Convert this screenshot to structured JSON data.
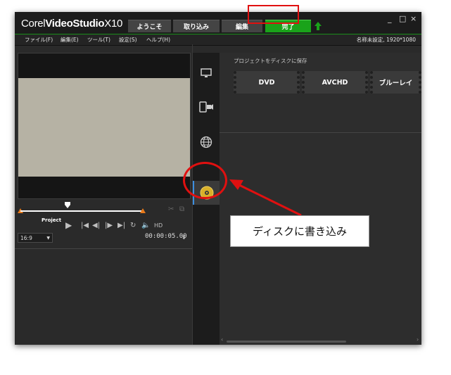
{
  "app": {
    "brand_left": "Corel",
    "brand_right": "VideoStudio",
    "brand_version": "X10"
  },
  "tabs": [
    {
      "label": "ようこそ"
    },
    {
      "label": "取り込み"
    },
    {
      "label": "編集"
    },
    {
      "label": "完了"
    }
  ],
  "window_controls": {
    "minimize": "_",
    "maximize": "□",
    "close": "×"
  },
  "menu": [
    {
      "label": "ファイル(F)"
    },
    {
      "label": "編集(E)"
    },
    {
      "label": "ツール(T)"
    },
    {
      "label": "設定(S)"
    },
    {
      "label": "ヘルプ(H)"
    }
  ],
  "project_info": "名称未設定, 1920*1080",
  "player": {
    "project_label": "Project",
    "ratio": "16:9",
    "timecode": "00:00:05.00",
    "hd_label": "HD"
  },
  "share": {
    "section_title": "プロジェクトをディスクに保存",
    "formats": [
      {
        "label": "DVD"
      },
      {
        "label": "AVCHD"
      },
      {
        "label": "ブルーレイ"
      }
    ]
  },
  "side_icons": [
    "monitor-icon",
    "mobile-device-icon",
    "web-globe-icon",
    "disc-icon"
  ],
  "annotation": {
    "callout_text": "ディスクに書き込み",
    "color": "#e01010"
  },
  "colors": {
    "active_tab": "#1aa31a",
    "scrub_end": "#e87a1a",
    "selected_edge": "#3d8fe0"
  }
}
